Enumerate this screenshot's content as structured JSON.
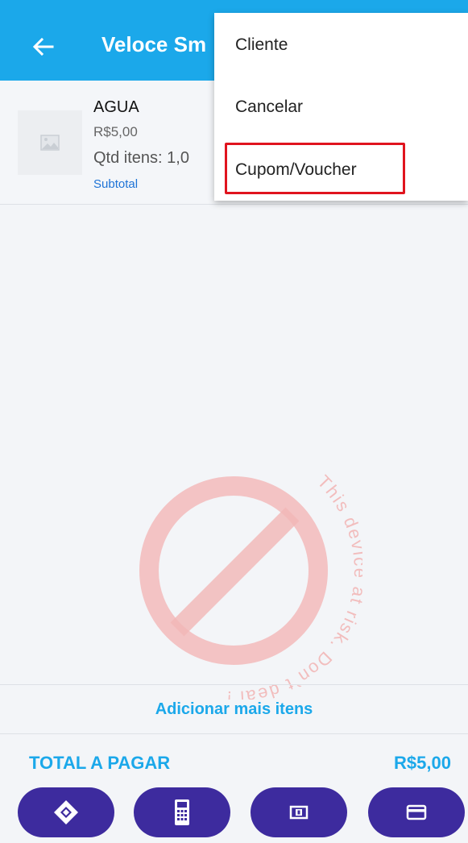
{
  "appbar": {
    "title": "Veloce Sm",
    "back_icon": "arrow-left-icon",
    "color": "#1ba8ea"
  },
  "cart": {
    "items": [
      {
        "name": "AGUA",
        "price": "R$5,00",
        "quantity": "Qtd itens: 1,0",
        "subtotal_link": "Subtotal",
        "image_icon": "image-placeholder-icon"
      }
    ]
  },
  "watermark": {
    "text": "This device at risk. Don`t deal !",
    "icon": "prohibited-icon"
  },
  "add_more": "Adicionar mais itens",
  "total": {
    "label": "TOTAL A PAGAR",
    "value": "R$5,00"
  },
  "payment_buttons": [
    {
      "icon": "pix-icon"
    },
    {
      "icon": "pos-terminal-icon"
    },
    {
      "icon": "cash-icon"
    },
    {
      "icon": "credit-card-icon"
    }
  ],
  "menu": {
    "items": [
      "Cliente",
      "Cancelar",
      "Cupom/Voucher"
    ],
    "highlighted_item": "Cupom/Voucher",
    "highlight_color": "#e0141e"
  },
  "colors": {
    "accent": "#1ba8ea",
    "button": "#3d2b9e",
    "link": "#1e73d6"
  }
}
